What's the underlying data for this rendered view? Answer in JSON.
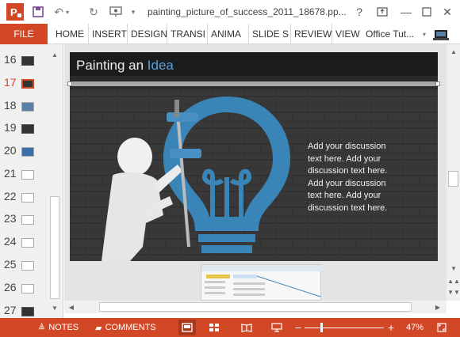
{
  "window": {
    "title": "painting_picture_of_success_2011_18678.pp...",
    "help": "?",
    "minimize": "—",
    "close": "✕"
  },
  "ribbon": {
    "file": "FILE",
    "tabs": [
      "HOME",
      "INSERT",
      "DESIGN",
      "TRANSI",
      "ANIMA",
      "SLIDE S",
      "REVIEW",
      "VIEW"
    ],
    "account": "Office Tut..."
  },
  "thumbnails": [
    {
      "num": "16"
    },
    {
      "num": "17"
    },
    {
      "num": "18"
    },
    {
      "num": "19"
    },
    {
      "num": "20"
    },
    {
      "num": "21"
    },
    {
      "num": "22"
    },
    {
      "num": "23"
    },
    {
      "num": "24"
    },
    {
      "num": "25"
    },
    {
      "num": "26"
    },
    {
      "num": "27"
    }
  ],
  "active_slide": "17",
  "slide": {
    "title_prefix": "Painting an ",
    "title_accent": "Idea",
    "discussion": "Add your discussion text here. Add your discussion text here. Add your discussion text here. Add your discussion text here."
  },
  "statusbar": {
    "notes": "NOTES",
    "comments": "COMMENTS",
    "zoom": "47%",
    "minus": "−",
    "plus": "+"
  },
  "colors": {
    "accent": "#d24726",
    "bulb": "#3a85b8",
    "title_accent": "#5aa0d8"
  }
}
